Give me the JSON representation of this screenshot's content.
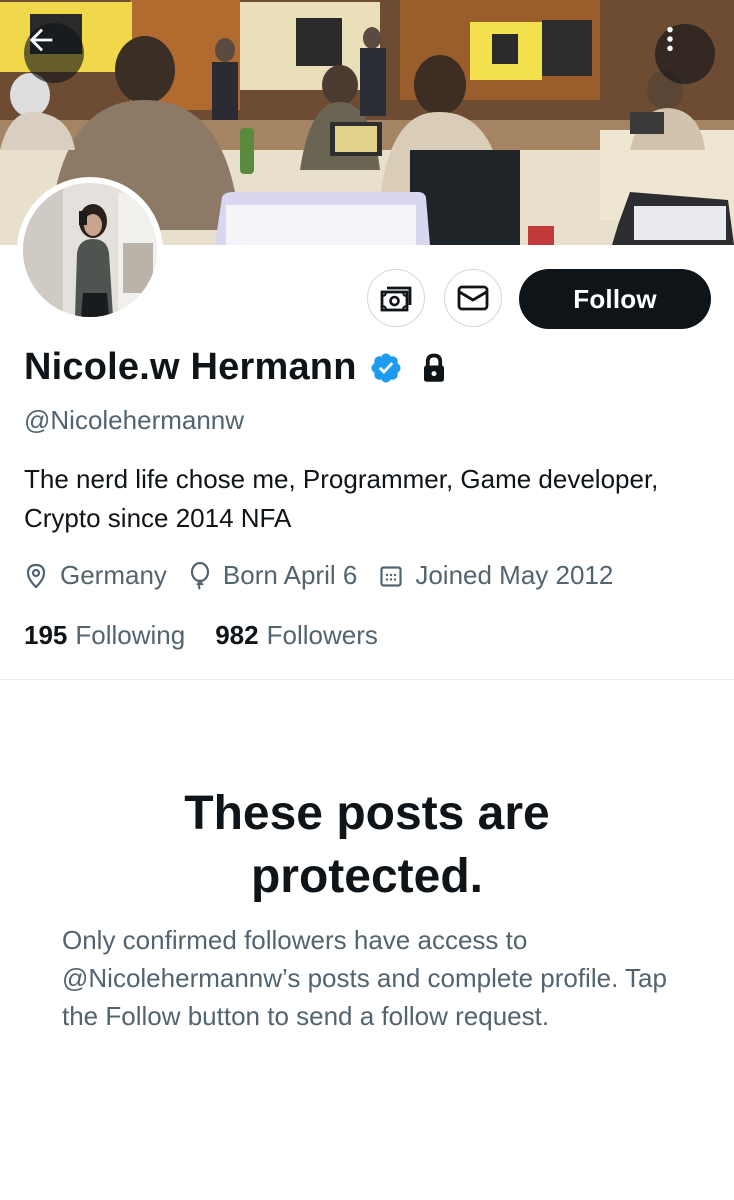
{
  "header": {
    "back_icon": "arrow-left-icon",
    "more_icon": "more-vertical-icon",
    "banner_description_icon": "banner-photo"
  },
  "profile": {
    "name": "Nicole.w Hermann",
    "handle": "@Nicolehermannw",
    "bio": "The nerd life chose me, Programmer, Game developer, Crypto since 2014 NFA",
    "location": "Germany",
    "birthday": "Born April 6",
    "joined": "Joined May 2012",
    "following_count": "195",
    "following_label": "Following",
    "followers_count": "982",
    "followers_label": "Followers",
    "verified_color": "#1d9bf0"
  },
  "actions": {
    "follow_label": "Follow",
    "tip_icon": "money-icon",
    "message_icon": "mail-icon"
  },
  "protected": {
    "title": "These posts are protected.",
    "message": "Only confirmed followers have access to @Nicolehermannw’s posts and complete profile. Tap the Follow button to send a follow request."
  },
  "colors": {
    "text": "#0f1419",
    "secondary": "#536471",
    "follow_bg": "#0f1419"
  }
}
